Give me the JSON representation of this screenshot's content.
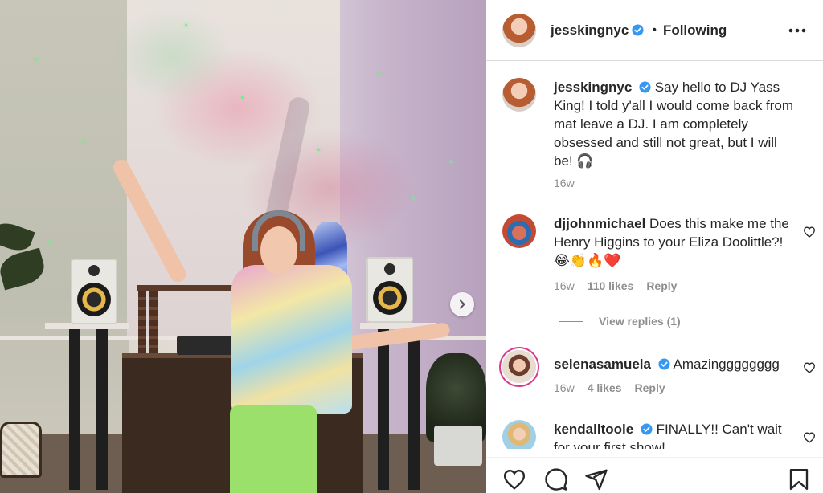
{
  "post": {
    "username": "jesskingnyc",
    "follow_state": "Following",
    "caption": "Say hello to DJ Yass King! I told y'all I would come back from mat leave a DJ. I am completely obsessed and still not great, but I will be! 🎧",
    "age": "16w"
  },
  "comments": [
    {
      "username": "djjohnmichael",
      "text": "Does this make me the Henry Higgins to your Eliza Doolittle?! 😂👏🔥❤️",
      "age": "16w",
      "likes": "110 likes",
      "reply": "Reply",
      "view_replies": "View replies (1)"
    },
    {
      "username": "selenasamuela",
      "text": "Amazingggggggg",
      "age": "16w",
      "likes": "4 likes",
      "reply": "Reply"
    },
    {
      "username": "kendalltoole",
      "text": "FINALLY!! Can't wait for your first show!"
    }
  ],
  "colors": {
    "verified": "#3897f0",
    "text": "#262626",
    "muted": "#8e8e8e",
    "divider": "#dbdbdb"
  },
  "icons": {
    "more": "more-options-icon",
    "next": "chevron-right-icon",
    "like": "heart-icon",
    "comment": "comment-icon",
    "share": "paper-plane-icon",
    "save": "bookmark-icon",
    "verified": "verified-badge-icon"
  }
}
